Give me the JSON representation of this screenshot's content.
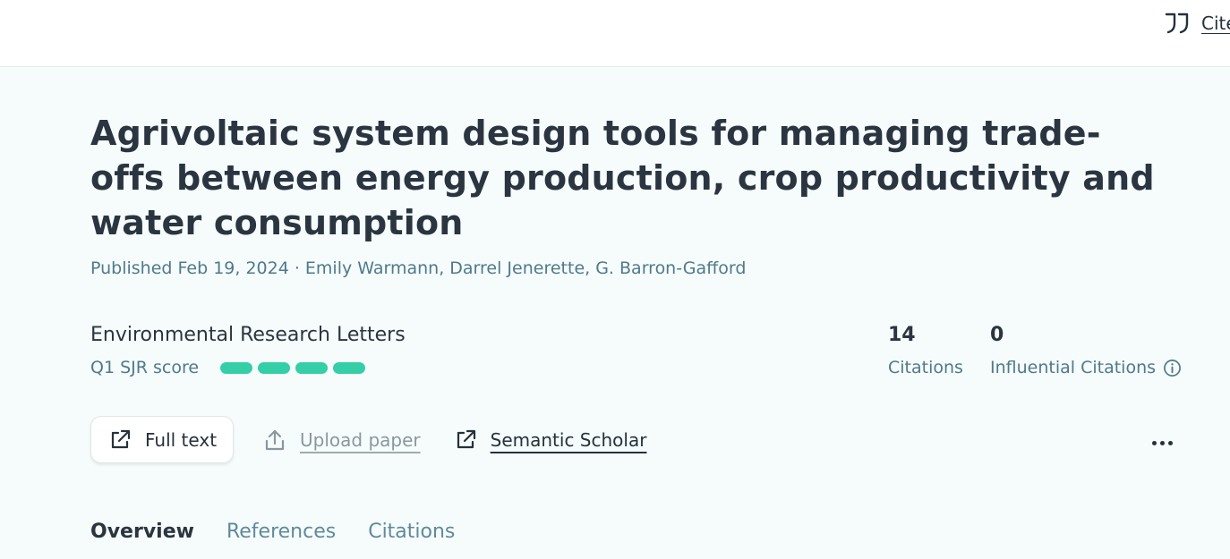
{
  "header": {
    "cite_label": "Cite",
    "cite_icon": "quote-icon"
  },
  "paper": {
    "title": "Agrivoltaic system design tools for managing trade-offs between energy production, crop productivity and water consumption",
    "meta": "Published Feb 19, 2024 · Emily Warmann, Darrel Jenerette, G. Barron-Gafford",
    "journal": "Environmental Research Letters",
    "sjr_label": "Q1 SJR score",
    "sjr_bars_filled": 4,
    "sjr_bar_color": "#35cfa7"
  },
  "stats": {
    "citations_count": "14",
    "citations_label": "Citations",
    "influential_count": "0",
    "influential_label": "Influential Citations"
  },
  "actions": {
    "full_text": "Full text",
    "upload": "Upload paper",
    "semantic_scholar": "Semantic Scholar"
  },
  "tabs": [
    {
      "label": "Overview",
      "active": true
    },
    {
      "label": "References",
      "active": false
    },
    {
      "label": "Citations",
      "active": false
    }
  ]
}
